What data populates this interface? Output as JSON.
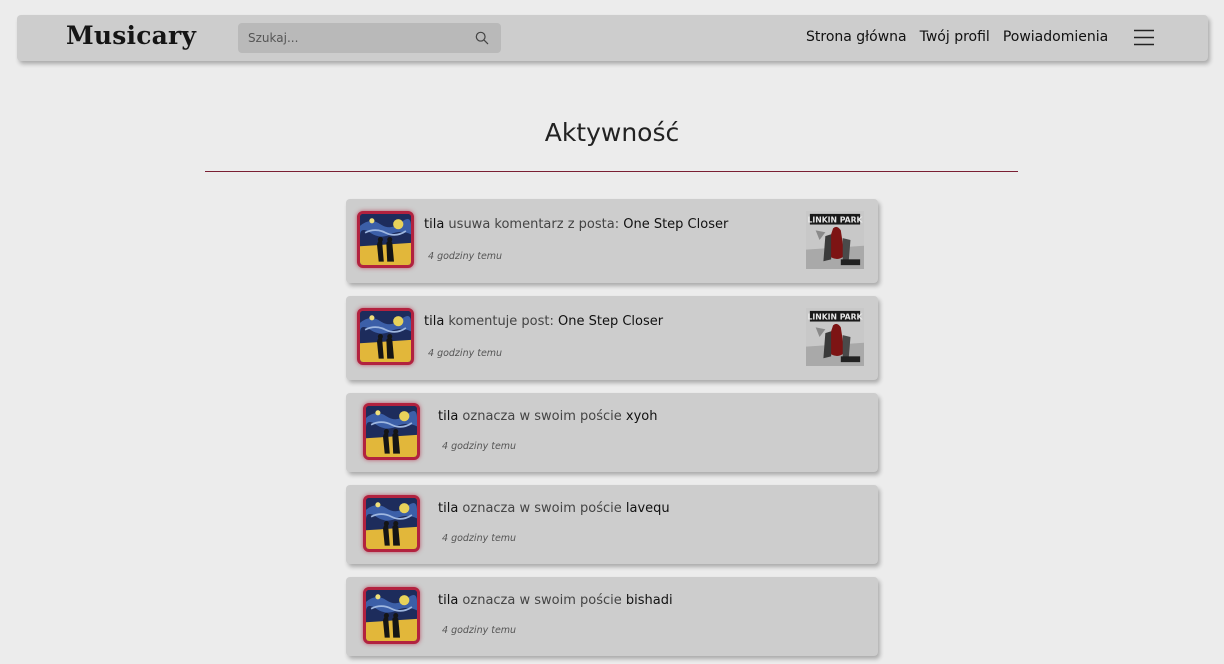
{
  "app": {
    "logo": "Musicary"
  },
  "search": {
    "placeholder": "Szukaj..."
  },
  "nav": {
    "home": "Strona główna",
    "profile": "Twój profil",
    "notifications": "Powiadomienia"
  },
  "page": {
    "title": "Aktywność"
  },
  "activities": [
    {
      "user": "tila",
      "action": " usuwa komentarz z posta: ",
      "target": "One Step Closer",
      "time": "4 godziny temu",
      "thumb": "LINKIN PARK"
    },
    {
      "user": "tila",
      "action": " komentuje post: ",
      "target": "One Step Closer",
      "time": "4 godziny temu",
      "thumb": "LINKIN PARK"
    },
    {
      "user": "tila",
      "action": " oznacza w swoim poście ",
      "target": "xyoh",
      "time": "4 godziny temu"
    },
    {
      "user": "tila",
      "action": " oznacza w swoim poście ",
      "target": "lavequ",
      "time": "4 godziny temu"
    },
    {
      "user": "tila",
      "action": " oznacza w swoim poście ",
      "target": "bishadi",
      "time": "4 godziny temu"
    }
  ],
  "colors": {
    "navbar": "#cdcdcd",
    "background": "#ececec",
    "accent": "#7a1f33",
    "avatar_border": "#b2223f",
    "search_bg": "#b9b9b9"
  },
  "icons": {
    "search": "search-icon",
    "menu": "hamburger-menu-icon"
  }
}
